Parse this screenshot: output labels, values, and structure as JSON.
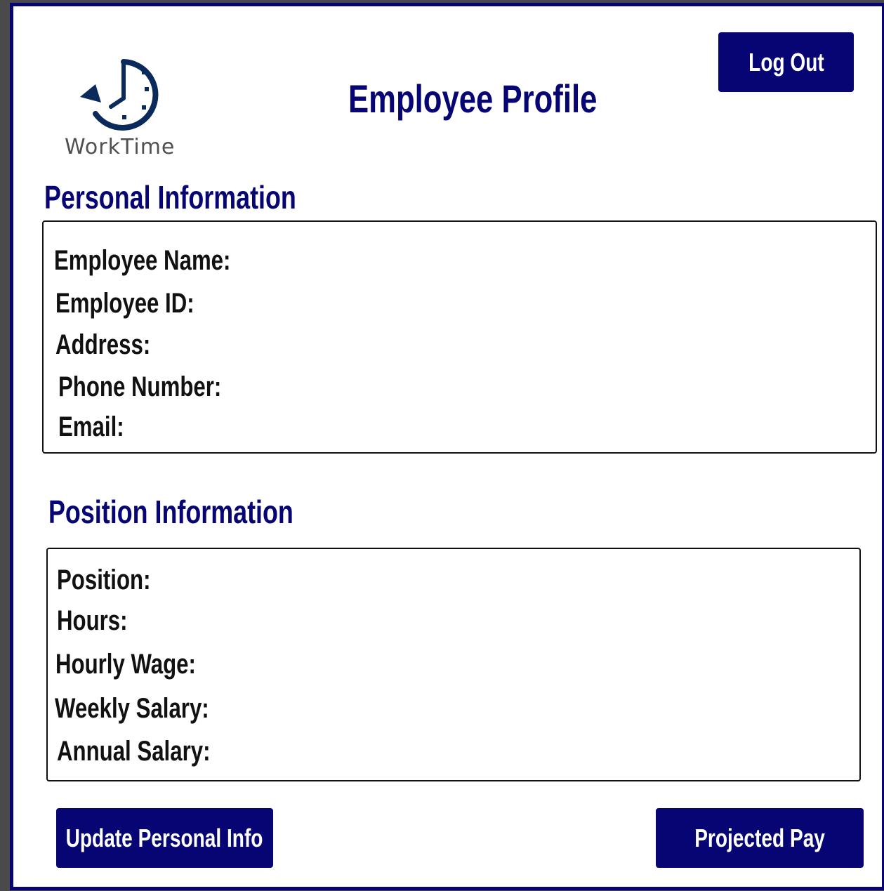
{
  "brand": {
    "name": "WorkTime",
    "icon": "clock-refresh-icon"
  },
  "header": {
    "title": "Employee Profile",
    "logout_label": "Log Out"
  },
  "personal": {
    "heading": "Personal Information",
    "fields": [
      "Employee Name:",
      "Employee ID:",
      "Address:",
      "Phone Number:",
      "Email:"
    ]
  },
  "position": {
    "heading": "Position Information",
    "fields": [
      "Position:",
      "Hours:",
      "Hourly Wage:",
      "Weekly Salary:",
      "Annual Salary:"
    ]
  },
  "actions": {
    "update_label": "Update Personal Info",
    "projected_label": "Projected Pay"
  },
  "colors": {
    "accent": "#070574",
    "background": "#ffffff",
    "outer": "#4a4a4a"
  }
}
